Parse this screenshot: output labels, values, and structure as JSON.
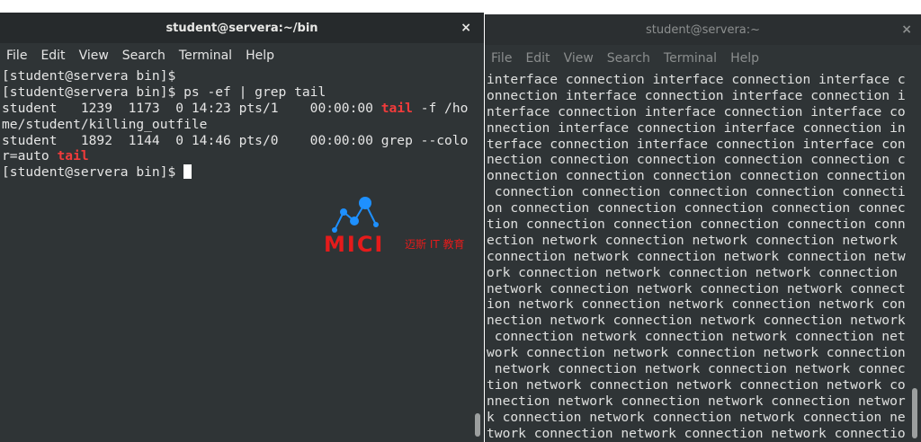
{
  "left_window": {
    "title": "student@servera:~/bin",
    "close_glyph": "×",
    "menu": [
      "File",
      "Edit",
      "View",
      "Search",
      "Terminal",
      "Help"
    ],
    "lines": [
      [
        {
          "t": "[student@servera bin]$"
        }
      ],
      [
        {
          "t": "[student@servera bin]$ ps -ef | grep tail"
        }
      ],
      [
        {
          "t": "student   1239  1173  0 14:23 pts/1    00:00:00 "
        },
        {
          "t": "tail",
          "hl": true
        },
        {
          "t": " -f /ho"
        }
      ],
      [
        {
          "t": "me/student/killing_outfile"
        }
      ],
      [
        {
          "t": "student   1892  1144  0 14:46 pts/0    00:00:00 grep --colo"
        }
      ],
      [
        {
          "t": "r=auto "
        },
        {
          "t": "tail",
          "hl": true
        }
      ],
      [
        {
          "t": "[student@servera bin]$ "
        },
        {
          "cursor": true
        }
      ]
    ]
  },
  "right_window": {
    "title": "student@servera:~",
    "close_glyph": "×",
    "menu": [
      "File",
      "Edit",
      "View",
      "Search",
      "Terminal",
      "Help"
    ],
    "lines": [
      "interface connection interface connection interface c",
      "onnection interface connection interface connection i",
      "nterface connection interface connection interface co",
      "nnection interface connection interface connection in",
      "terface connection interface connection interface con",
      "nection connection connection connection connection c",
      "onnection connection connection connection connection",
      " connection connection connection connection connecti",
      "on connection connection connection connection connec",
      "tion connection connection connection connection conn",
      "ection network connection network connection network ",
      "connection network connection network connection netw",
      "ork connection network connection network connection ",
      "network connection network connection network connect",
      "ion network connection network connection network con",
      "nection network connection network connection network",
      " connection network connection network connection net",
      "work connection network connection network connection",
      " network connection network connection network connec",
      "tion network connection network connection network co",
      "nnection network connection network connection networ",
      "k connection network connection network connection ne",
      "twork connection network connection network connectio"
    ]
  },
  "watermark": {
    "brand": "MICI",
    "subtitle": "迈斯 IT 教育",
    "color": "#e51b1b",
    "icon_color": "#1e90ff"
  }
}
